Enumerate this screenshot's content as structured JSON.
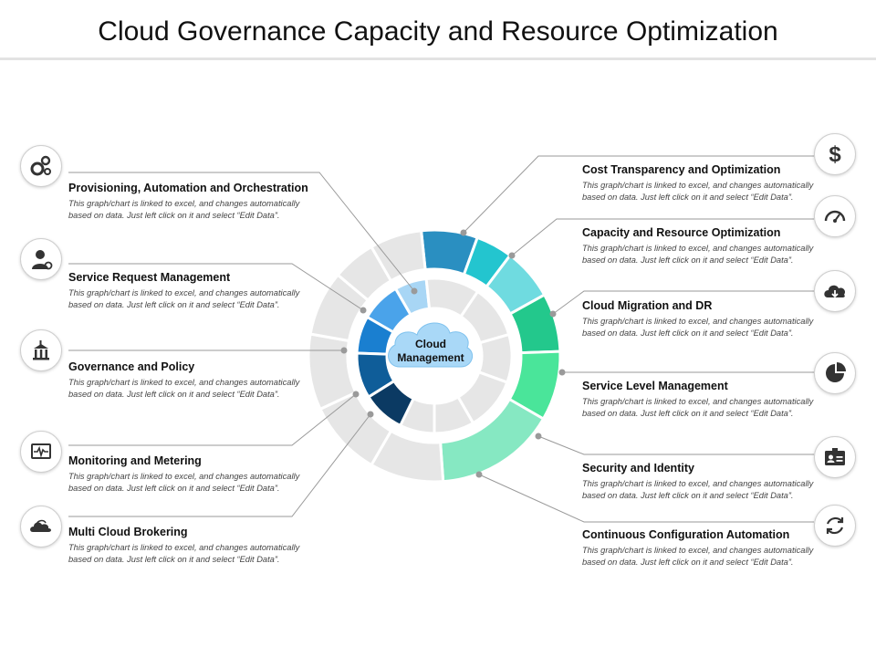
{
  "title": "Cloud Governance Capacity and Resource Optimization",
  "center": {
    "line1": "Cloud",
    "line2": "Management"
  },
  "description": "This graph/chart is linked to excel, and changes automatically based on data. Just left click on it and select “Edit Data”.",
  "left_items": [
    {
      "heading": "Provisioning,  Automation and Orchestration",
      "icon": "gears-icon"
    },
    {
      "heading": "Service Request Management",
      "icon": "support-agent-icon"
    },
    {
      "heading": "Governance and Policy",
      "icon": "government-building-icon"
    },
    {
      "heading": "Monitoring and Metering",
      "icon": "monitor-pulse-icon"
    },
    {
      "heading": "Multi Cloud Brokering",
      "icon": "multi-cloud-icon"
    }
  ],
  "right_items": [
    {
      "heading": "Cost  Transparency and Optimization",
      "icon": "dollar-icon"
    },
    {
      "heading": "Capacity and Resource Optimization",
      "icon": "speedometer-icon"
    },
    {
      "heading": "Cloud Migration and DR",
      "icon": "cloud-download-icon"
    },
    {
      "heading": "Service  Level Management",
      "icon": "pie-chart-icon"
    },
    {
      "heading": "Security and Identity",
      "icon": "id-card-icon"
    },
    {
      "heading": "Continuous  Configuration Automation",
      "icon": "refresh-icon"
    }
  ],
  "colors": {
    "outer_right": [
      "#2a8fc1",
      "#23c5cf",
      "#6fdbe0",
      "#23c88c",
      "#4ae59a",
      "#86e8c2"
    ],
    "inner_left": [
      "#a8d6f5",
      "#4aa3ea",
      "#1a7fd0",
      "#0f5d99",
      "#0b3a63"
    ],
    "ring_grey": "#e6e6e6",
    "connector": "#9a9a9a",
    "center_cloud": "#a9d8f7"
  }
}
